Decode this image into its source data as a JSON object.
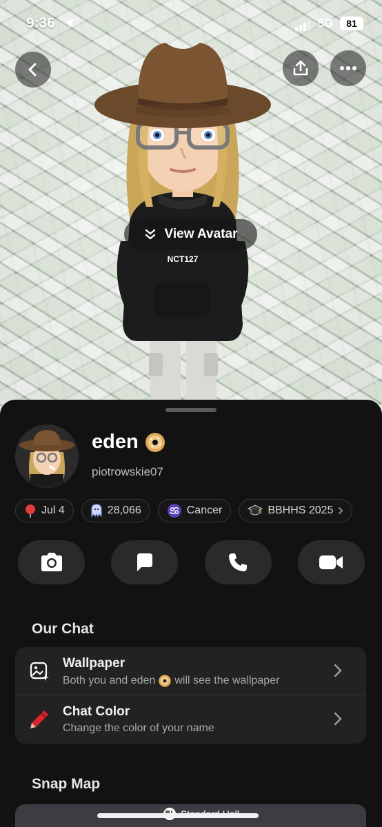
{
  "status_bar": {
    "time": "9:36",
    "network": "5G",
    "battery": "81"
  },
  "hero": {
    "view_avatar_label": "View Avatar",
    "hoodie_text": "NCT127"
  },
  "profile": {
    "display_name": "eden",
    "username": "piotrowskie07",
    "chips": [
      {
        "icon": "pin-icon",
        "label": "Jul 4"
      },
      {
        "icon": "ghost-icon",
        "label": "28,066"
      },
      {
        "icon": "cancer-zodiac-icon",
        "label": "Cancer"
      },
      {
        "icon": "graduation-cap-icon",
        "label": "BBHHS 2025"
      }
    ]
  },
  "actions": [
    "camera-icon",
    "chat-icon",
    "phone-icon",
    "video-icon"
  ],
  "our_chat": {
    "title": "Our Chat",
    "rows": [
      {
        "title": "Wallpaper",
        "subtitle_pre": "Both you and eden",
        "subtitle_post": "will see the wallpaper"
      },
      {
        "title": "Chat Color",
        "subtitle": "Change the color of your name"
      }
    ]
  },
  "snap_map": {
    "title": "Snap Map",
    "place_label": "Standard Hall"
  },
  "colors": {
    "sheet_bg": "#121212",
    "card_bg": "#222222",
    "accent_pin": "#e23b3b",
    "zodiac": "#5a3fb8"
  }
}
